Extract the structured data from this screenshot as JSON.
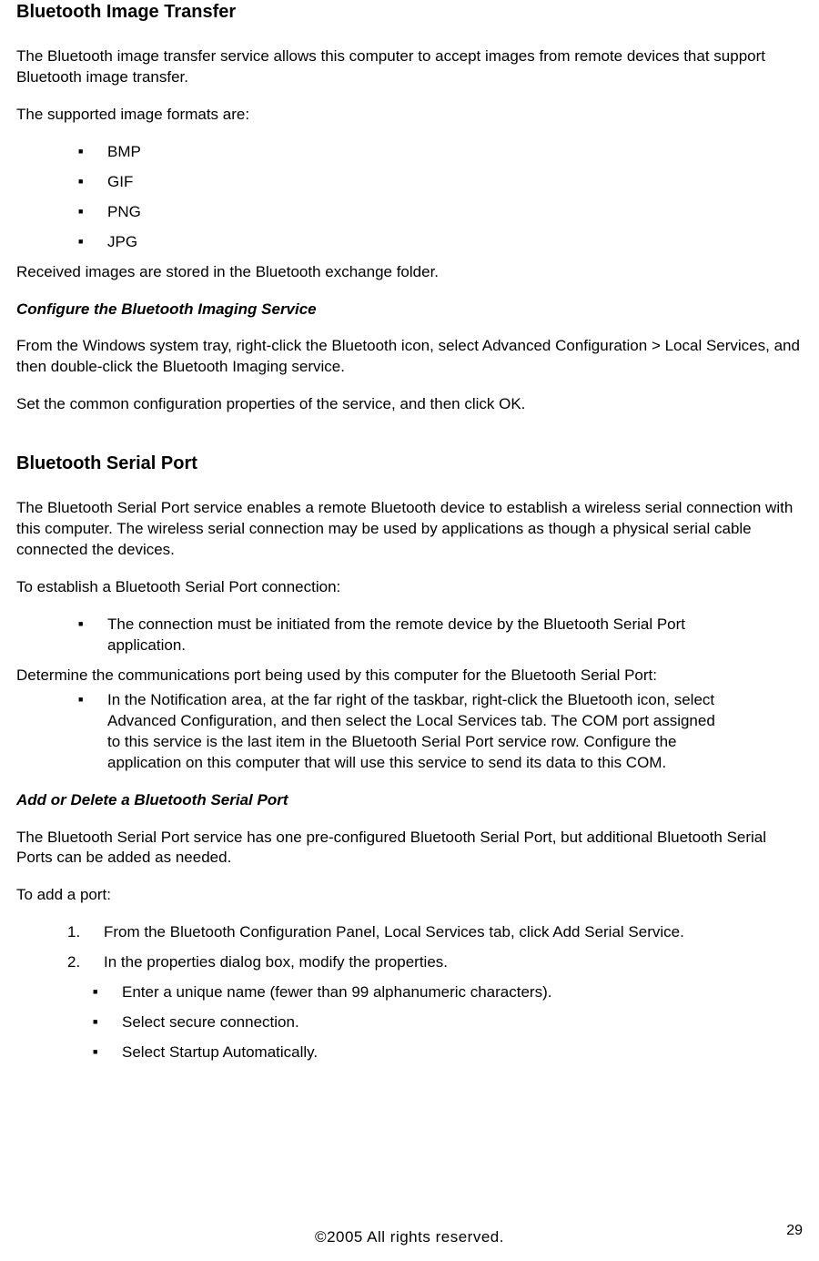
{
  "section1": {
    "heading": "Bluetooth Image Transfer",
    "intro": "The Bluetooth image transfer service allows this computer to accept images from remote devices that support Bluetooth image transfer.",
    "formats_lead": "The supported image formats are:",
    "formats": [
      "BMP",
      "GIF",
      "PNG",
      "JPG"
    ],
    "storage_note": "Received images are stored in the Bluetooth exchange folder.",
    "subheading": "Configure the Bluetooth Imaging Service",
    "config1": "From the Windows system tray, right-click the Bluetooth icon, select Advanced Configuration > Local Services, and then double-click the Bluetooth Imaging service.",
    "config2": "Set the common configuration properties of the service, and then click OK."
  },
  "section2": {
    "heading": "Bluetooth Serial Port",
    "intro": "The Bluetooth Serial Port service enables a remote Bluetooth device to establish a wireless serial connection with this computer. The wireless serial connection may be used by applications as though a physical serial cable connected the devices.",
    "establish_lead": "To establish a Bluetooth Serial Port connection:",
    "establish_bullet": "The connection must be initiated from the remote device by the Bluetooth Serial Port application.",
    "determine_lead": "Determine the communications port being used by this computer for the Bluetooth Serial Port:",
    "determine_bullet": "In the Notification area, at the far right of the taskbar, right-click the Bluetooth icon, select Advanced Configuration, and then select the Local Services tab. The COM port assigned to this service is the last item in the Bluetooth Serial Port service row. Configure the application on this computer that will use this service to send its data to this COM.",
    "subheading": "Add or Delete a Bluetooth Serial Port",
    "add_intro": "The Bluetooth Serial Port service has one pre-configured Bluetooth Serial Port, but additional Bluetooth Serial Ports can be added as needed.",
    "add_lead": "To add a port:",
    "steps": [
      "From the Bluetooth Configuration Panel, Local Services tab, click Add Serial Service.",
      "In the properties dialog box, modify the properties."
    ],
    "sub_bullets": [
      "Enter a unique name (fewer than 99 alphanumeric characters).",
      "Select secure connection.",
      "Select Startup Automatically."
    ]
  },
  "footer": {
    "copyright": "©2005 All rights reserved.",
    "page": "29"
  }
}
